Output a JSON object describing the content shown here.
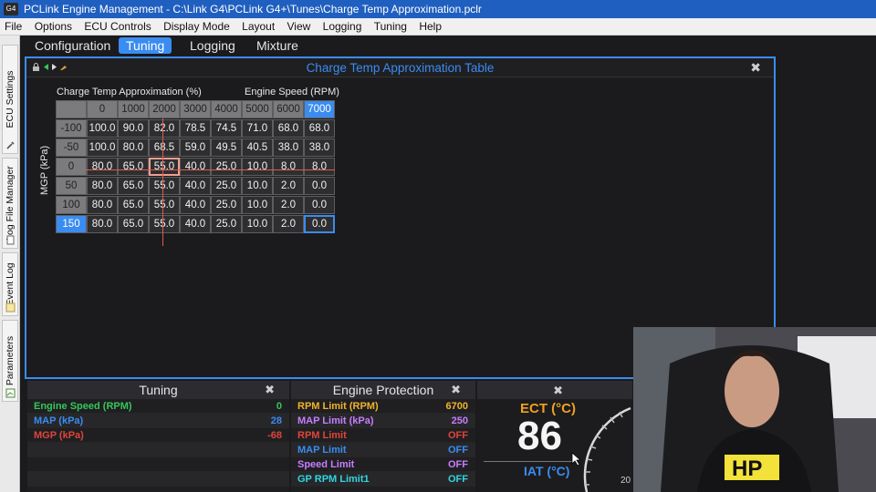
{
  "window": {
    "title": "PCLink Engine Management - C:\\Link G4\\PCLink G4+\\Tunes\\Charge Temp Approximation.pclr",
    "logo": "G4"
  },
  "menu": [
    "File",
    "Options",
    "ECU Controls",
    "Display Mode",
    "Layout",
    "View",
    "Logging",
    "Tuning",
    "Help"
  ],
  "sidebar_tabs": [
    "ECU Settings",
    "Log File Manager",
    "Event Log",
    "Parameters"
  ],
  "tabs": [
    {
      "label": "Configuration",
      "active": false
    },
    {
      "label": "Tuning",
      "active": true
    },
    {
      "label": "Logging",
      "active": false
    },
    {
      "label": "Mixture Map",
      "active": false
    }
  ],
  "table_panel": {
    "title": "Charge Temp Approximation Table",
    "value_title": "Charge Temp Approximation (%)",
    "x_axis_title": "Engine Speed (RPM)",
    "y_axis_title": "MGP (kPa)",
    "x_values": [
      "0",
      "1000",
      "2000",
      "3000",
      "4000",
      "5000",
      "6000",
      "7000"
    ],
    "y_values": [
      "-100",
      "-50",
      "0",
      "50",
      "100",
      "150"
    ],
    "rows": [
      [
        "100.0",
        "90.0",
        "82.0",
        "78.5",
        "74.5",
        "71.0",
        "68.0",
        "68.0"
      ],
      [
        "100.0",
        "80.0",
        "68.5",
        "59.0",
        "49.5",
        "40.5",
        "38.0",
        "38.0"
      ],
      [
        "80.0",
        "65.0",
        "55.0",
        "40.0",
        "25.0",
        "10.0",
        "8.0",
        "8.0"
      ],
      [
        "80.0",
        "65.0",
        "55.0",
        "40.0",
        "25.0",
        "10.0",
        "2.0",
        "0.0"
      ],
      [
        "80.0",
        "65.0",
        "55.0",
        "40.0",
        "25.0",
        "10.0",
        "2.0",
        "0.0"
      ],
      [
        "80.0",
        "65.0",
        "55.0",
        "40.0",
        "25.0",
        "10.0",
        "2.0",
        "0.0"
      ]
    ],
    "selected_x_index": 7,
    "selected_y_index": 5
  },
  "tuning_panel": {
    "title": "Tuning",
    "rows": [
      {
        "label": "Engine Speed (RPM)",
        "value": "0",
        "color": "#34c759"
      },
      {
        "label": "MAP (kPa)",
        "value": "28",
        "color": "#3a8cf0"
      },
      {
        "label": "MGP (kPa)",
        "value": "-68",
        "color": "#e0453a"
      }
    ]
  },
  "protection_panel": {
    "title": "Engine Protection",
    "rows": [
      {
        "label": "RPM Limit (RPM)",
        "value": "6700",
        "color": "#f0b429"
      },
      {
        "label": "MAP Limit (kPa)",
        "value": "250",
        "color": "#c77dff"
      },
      {
        "label": "RPM Limit",
        "value": "OFF",
        "color": "#e0453a"
      },
      {
        "label": "MAP Limit",
        "value": "OFF",
        "color": "#3a8cf0"
      },
      {
        "label": "Speed Limit",
        "value": "OFF",
        "color": "#c77dff"
      },
      {
        "label": "GP RPM Limit1",
        "value": "OFF",
        "color": "#32d6e0"
      }
    ]
  },
  "gauge_panel": {
    "ect_label": "ECT (°C)",
    "ect_value": "86",
    "iat_label": "IAT (°C)",
    "dial_tick": "20"
  }
}
